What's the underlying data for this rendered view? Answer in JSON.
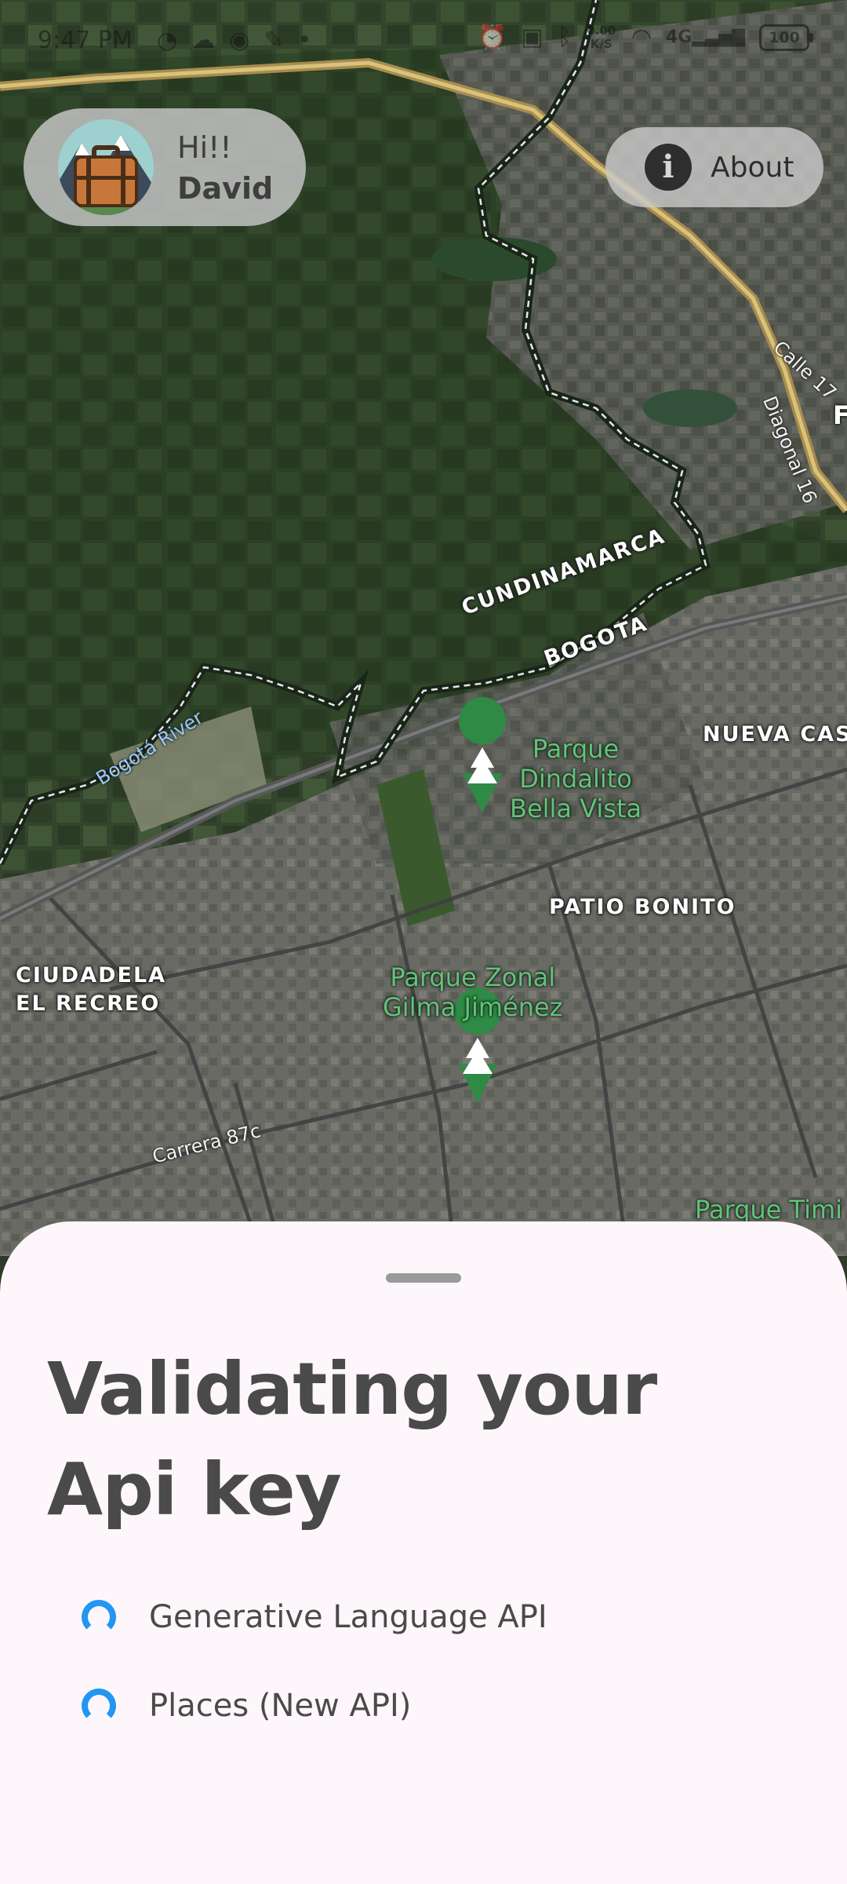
{
  "status_bar": {
    "time": "9:47 PM",
    "net_speed": "0.00 K/S",
    "network": "4G",
    "battery": "100"
  },
  "user": {
    "greeting": "Hi!!",
    "name": "David"
  },
  "about_button": {
    "label": "About",
    "icon": "info-icon"
  },
  "map": {
    "labels": {
      "cundinamarca": "CUNDINAMARCA",
      "bogota": "BOGOTA",
      "nueva_castilla": "NUEVA CAS",
      "patio_bonito": "PATIO BONITO",
      "ciudadela_line1": "CIUDADELA",
      "ciudadela_line2": "EL RECREO",
      "park1_line1": "Parque",
      "park1_line2": "Dindalito",
      "park1_line3": "Bella Vista",
      "park2_line1": "Parque Zonal",
      "park2_line2": "Gilma Jiménez",
      "park3": "Parque Timi",
      "river": "Bogotá River",
      "road_calle17": "Calle 17",
      "road_diagonal16": "Diagonal 16",
      "road_carrera87c": "Carrera 87c",
      "edge_letter": "F"
    },
    "pin_icon": "tree-pin-icon"
  },
  "sheet": {
    "title": "Validating your Api key",
    "items": [
      {
        "label": "Generative Language API",
        "status_icon": "loading-spinner-icon"
      },
      {
        "label": "Places (New API)",
        "status_icon": "loading-spinner-icon"
      }
    ]
  }
}
